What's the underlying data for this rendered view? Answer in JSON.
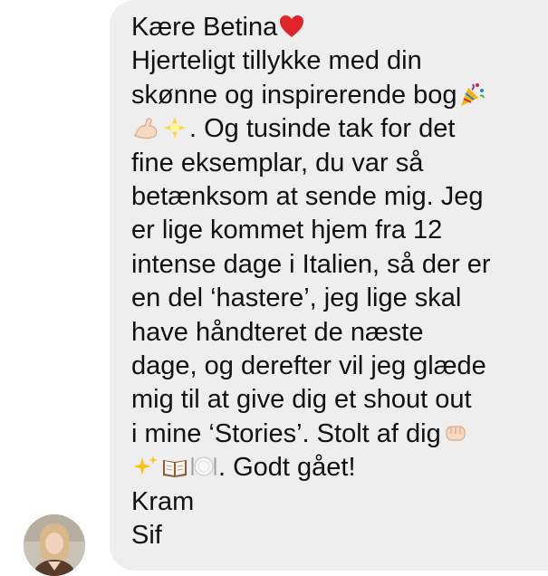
{
  "message": {
    "lines": [
      {
        "text": "Kære Betina",
        "emoji": [
          "red-heart"
        ]
      },
      {
        "text": "Hjerteligt tillykke med din",
        "emoji": []
      },
      {
        "text": "skønne og inspirerende bog",
        "emoji": [
          "party-popper"
        ]
      },
      {
        "text": ". Og tusinde tak for det",
        "lead_emoji": [
          "flexed-biceps",
          "glowing-star"
        ]
      },
      {
        "text": "fine eksemplar, du var så",
        "emoji": []
      },
      {
        "text": "betænksom at sende mig. Jeg",
        "emoji": []
      },
      {
        "text": "er lige kommet hjem fra 12",
        "emoji": []
      },
      {
        "text": "intense dage i Italien, så der er",
        "emoji": []
      },
      {
        "text": "en del ‘hastere’, jeg lige skal",
        "emoji": []
      },
      {
        "text": "have håndteret de næste",
        "emoji": []
      },
      {
        "text": "dage, og derefter vil jeg glæde",
        "emoji": []
      },
      {
        "text": "mig til at give dig et shout out",
        "emoji": []
      },
      {
        "text": "i mine ‘Stories’. Stolt af dig",
        "emoji": [
          "oncoming-fist"
        ]
      },
      {
        "text": ". Godt gået!",
        "lead_emoji": [
          "sparkles",
          "open-book",
          "plate-with-cutlery"
        ]
      },
      {
        "text": "Kram",
        "emoji": []
      },
      {
        "text": "Sif",
        "emoji": []
      }
    ]
  },
  "sender": {
    "avatar": "profile-photo"
  },
  "colors": {
    "bubble": "#eeeeee",
    "text": "#111111",
    "heart": "#e0242a"
  }
}
